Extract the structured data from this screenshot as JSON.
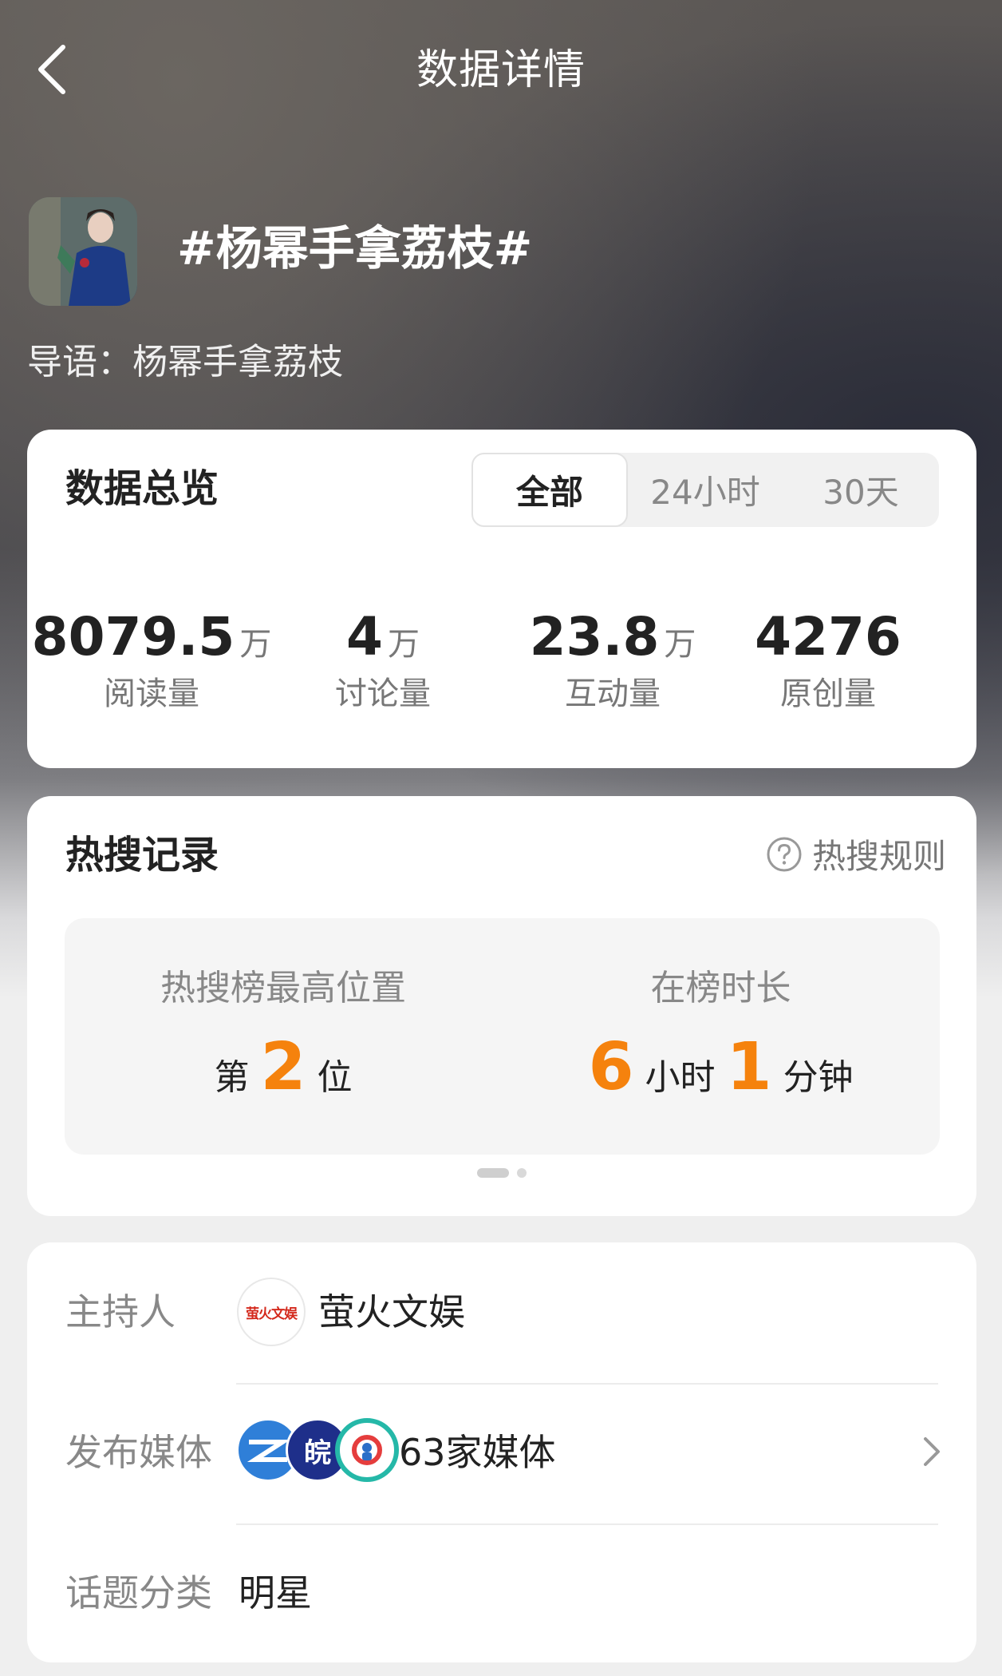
{
  "header": {
    "title": "数据详情",
    "back_icon": "chevron-left-icon"
  },
  "topic": {
    "title": "#杨幂手拿荔枝#",
    "intro": "导语：杨幂手拿荔枝"
  },
  "overview": {
    "title": "数据总览",
    "tabs": [
      {
        "label": "全部",
        "active": true
      },
      {
        "label": "24小时",
        "active": false
      },
      {
        "label": "30天",
        "active": false
      }
    ],
    "stats": [
      {
        "value": "8079.5",
        "unit": "万",
        "label": "阅读量"
      },
      {
        "value": "4",
        "unit": "万",
        "label": "讨论量"
      },
      {
        "value": "23.8",
        "unit": "万",
        "label": "互动量"
      },
      {
        "value": "4276",
        "unit": "",
        "label": "原创量"
      }
    ]
  },
  "hot_search": {
    "title": "热搜记录",
    "rules_label": "热搜规则",
    "rules_icon": "question-circle-icon",
    "highest_position": {
      "label": "热搜榜最高位置",
      "prefix": "第",
      "value": "2",
      "suffix": "位"
    },
    "duration": {
      "label": "在榜时长",
      "hours": "6",
      "hours_unit": "小时",
      "minutes": "1",
      "minutes_unit": "分钟"
    },
    "page_indicator": {
      "pages": 2,
      "current": 1
    }
  },
  "info": {
    "host": {
      "label": "主持人",
      "logo_text": "萤火文娱",
      "name": "萤火文娱"
    },
    "media": {
      "label": "发布媒体",
      "count_text": "63家媒体",
      "logo_texts": [
        "",
        "皖",
        ""
      ]
    },
    "category": {
      "label": "话题分类",
      "value": "明星"
    }
  },
  "colors": {
    "accent_orange": "#f5820d",
    "card_bg": "#ffffff",
    "page_bg": "#efefef"
  }
}
